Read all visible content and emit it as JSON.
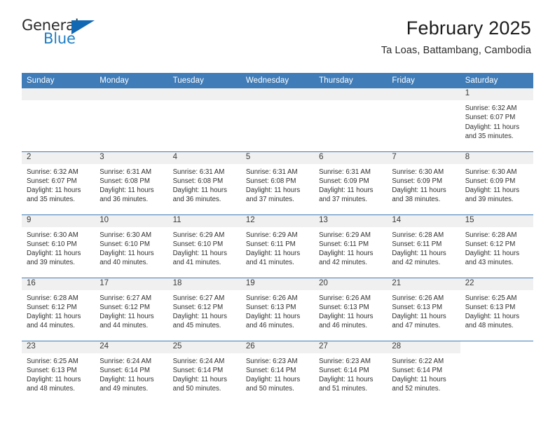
{
  "brand": {
    "name_part1": "General",
    "name_part2": "Blue",
    "accent_color": "#1f7ec4",
    "triangle_color": "#1268b3"
  },
  "header": {
    "title": "February 2025",
    "subtitle": "Ta Loas, Battambang, Cambodia"
  },
  "theme": {
    "header_blue": "#3f7cb8",
    "daynum_strip": "#f0f0f0"
  },
  "weekdays": [
    "Sunday",
    "Monday",
    "Tuesday",
    "Wednesday",
    "Thursday",
    "Friday",
    "Saturday"
  ],
  "labels": {
    "sunrise_prefix": "Sunrise:",
    "sunset_prefix": "Sunset:",
    "daylight_prefix": "Daylight:"
  },
  "weeks": [
    [
      {
        "day": "",
        "sunrise": "",
        "sunset": "",
        "daylight": "",
        "empty": true
      },
      {
        "day": "",
        "sunrise": "",
        "sunset": "",
        "daylight": "",
        "empty": true
      },
      {
        "day": "",
        "sunrise": "",
        "sunset": "",
        "daylight": "",
        "empty": true
      },
      {
        "day": "",
        "sunrise": "",
        "sunset": "",
        "daylight": "",
        "empty": true
      },
      {
        "day": "",
        "sunrise": "",
        "sunset": "",
        "daylight": "",
        "empty": true
      },
      {
        "day": "",
        "sunrise": "",
        "sunset": "",
        "daylight": "",
        "empty": true
      },
      {
        "day": "1",
        "sunrise": "Sunrise: 6:32 AM",
        "sunset": "Sunset: 6:07 PM",
        "daylight": "Daylight: 11 hours and 35 minutes.",
        "empty": false
      }
    ],
    [
      {
        "day": "2",
        "sunrise": "Sunrise: 6:32 AM",
        "sunset": "Sunset: 6:07 PM",
        "daylight": "Daylight: 11 hours and 35 minutes.",
        "empty": false
      },
      {
        "day": "3",
        "sunrise": "Sunrise: 6:31 AM",
        "sunset": "Sunset: 6:08 PM",
        "daylight": "Daylight: 11 hours and 36 minutes.",
        "empty": false
      },
      {
        "day": "4",
        "sunrise": "Sunrise: 6:31 AM",
        "sunset": "Sunset: 6:08 PM",
        "daylight": "Daylight: 11 hours and 36 minutes.",
        "empty": false
      },
      {
        "day": "5",
        "sunrise": "Sunrise: 6:31 AM",
        "sunset": "Sunset: 6:08 PM",
        "daylight": "Daylight: 11 hours and 37 minutes.",
        "empty": false
      },
      {
        "day": "6",
        "sunrise": "Sunrise: 6:31 AM",
        "sunset": "Sunset: 6:09 PM",
        "daylight": "Daylight: 11 hours and 37 minutes.",
        "empty": false
      },
      {
        "day": "7",
        "sunrise": "Sunrise: 6:30 AM",
        "sunset": "Sunset: 6:09 PM",
        "daylight": "Daylight: 11 hours and 38 minutes.",
        "empty": false
      },
      {
        "day": "8",
        "sunrise": "Sunrise: 6:30 AM",
        "sunset": "Sunset: 6:09 PM",
        "daylight": "Daylight: 11 hours and 39 minutes.",
        "empty": false
      }
    ],
    [
      {
        "day": "9",
        "sunrise": "Sunrise: 6:30 AM",
        "sunset": "Sunset: 6:10 PM",
        "daylight": "Daylight: 11 hours and 39 minutes.",
        "empty": false
      },
      {
        "day": "10",
        "sunrise": "Sunrise: 6:30 AM",
        "sunset": "Sunset: 6:10 PM",
        "daylight": "Daylight: 11 hours and 40 minutes.",
        "empty": false
      },
      {
        "day": "11",
        "sunrise": "Sunrise: 6:29 AM",
        "sunset": "Sunset: 6:10 PM",
        "daylight": "Daylight: 11 hours and 41 minutes.",
        "empty": false
      },
      {
        "day": "12",
        "sunrise": "Sunrise: 6:29 AM",
        "sunset": "Sunset: 6:11 PM",
        "daylight": "Daylight: 11 hours and 41 minutes.",
        "empty": false
      },
      {
        "day": "13",
        "sunrise": "Sunrise: 6:29 AM",
        "sunset": "Sunset: 6:11 PM",
        "daylight": "Daylight: 11 hours and 42 minutes.",
        "empty": false
      },
      {
        "day": "14",
        "sunrise": "Sunrise: 6:28 AM",
        "sunset": "Sunset: 6:11 PM",
        "daylight": "Daylight: 11 hours and 42 minutes.",
        "empty": false
      },
      {
        "day": "15",
        "sunrise": "Sunrise: 6:28 AM",
        "sunset": "Sunset: 6:12 PM",
        "daylight": "Daylight: 11 hours and 43 minutes.",
        "empty": false
      }
    ],
    [
      {
        "day": "16",
        "sunrise": "Sunrise: 6:28 AM",
        "sunset": "Sunset: 6:12 PM",
        "daylight": "Daylight: 11 hours and 44 minutes.",
        "empty": false
      },
      {
        "day": "17",
        "sunrise": "Sunrise: 6:27 AM",
        "sunset": "Sunset: 6:12 PM",
        "daylight": "Daylight: 11 hours and 44 minutes.",
        "empty": false
      },
      {
        "day": "18",
        "sunrise": "Sunrise: 6:27 AM",
        "sunset": "Sunset: 6:12 PM",
        "daylight": "Daylight: 11 hours and 45 minutes.",
        "empty": false
      },
      {
        "day": "19",
        "sunrise": "Sunrise: 6:26 AM",
        "sunset": "Sunset: 6:13 PM",
        "daylight": "Daylight: 11 hours and 46 minutes.",
        "empty": false
      },
      {
        "day": "20",
        "sunrise": "Sunrise: 6:26 AM",
        "sunset": "Sunset: 6:13 PM",
        "daylight": "Daylight: 11 hours and 46 minutes.",
        "empty": false
      },
      {
        "day": "21",
        "sunrise": "Sunrise: 6:26 AM",
        "sunset": "Sunset: 6:13 PM",
        "daylight": "Daylight: 11 hours and 47 minutes.",
        "empty": false
      },
      {
        "day": "22",
        "sunrise": "Sunrise: 6:25 AM",
        "sunset": "Sunset: 6:13 PM",
        "daylight": "Daylight: 11 hours and 48 minutes.",
        "empty": false
      }
    ],
    [
      {
        "day": "23",
        "sunrise": "Sunrise: 6:25 AM",
        "sunset": "Sunset: 6:13 PM",
        "daylight": "Daylight: 11 hours and 48 minutes.",
        "empty": false
      },
      {
        "day": "24",
        "sunrise": "Sunrise: 6:24 AM",
        "sunset": "Sunset: 6:14 PM",
        "daylight": "Daylight: 11 hours and 49 minutes.",
        "empty": false
      },
      {
        "day": "25",
        "sunrise": "Sunrise: 6:24 AM",
        "sunset": "Sunset: 6:14 PM",
        "daylight": "Daylight: 11 hours and 50 minutes.",
        "empty": false
      },
      {
        "day": "26",
        "sunrise": "Sunrise: 6:23 AM",
        "sunset": "Sunset: 6:14 PM",
        "daylight": "Daylight: 11 hours and 50 minutes.",
        "empty": false
      },
      {
        "day": "27",
        "sunrise": "Sunrise: 6:23 AM",
        "sunset": "Sunset: 6:14 PM",
        "daylight": "Daylight: 11 hours and 51 minutes.",
        "empty": false
      },
      {
        "day": "28",
        "sunrise": "Sunrise: 6:22 AM",
        "sunset": "Sunset: 6:14 PM",
        "daylight": "Daylight: 11 hours and 52 minutes.",
        "empty": false
      },
      {
        "day": "",
        "sunrise": "",
        "sunset": "",
        "daylight": "",
        "empty": true,
        "blank": true
      }
    ]
  ]
}
